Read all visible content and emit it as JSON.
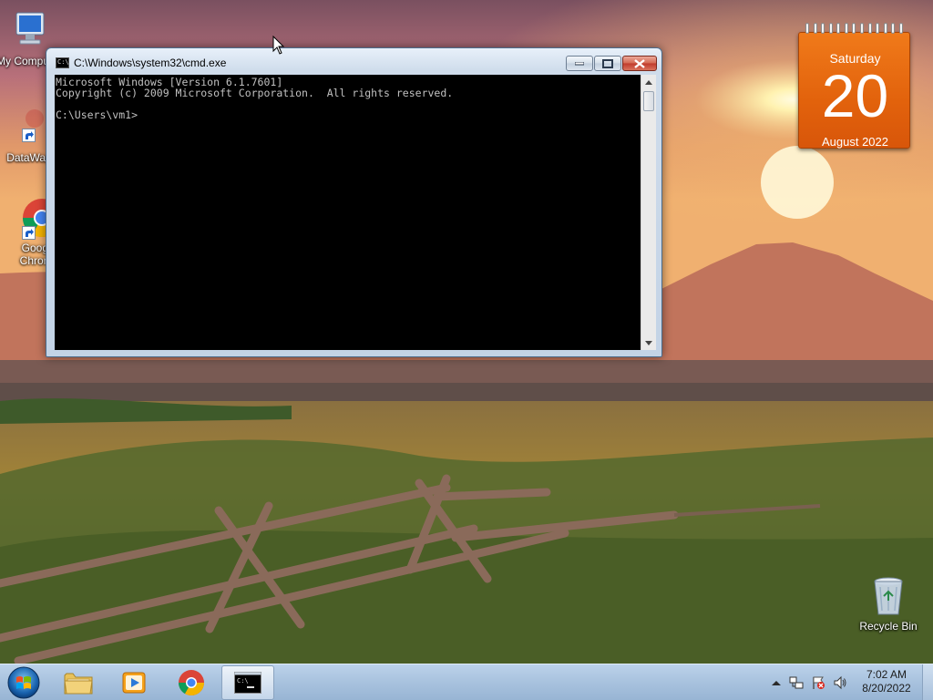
{
  "desktop": {
    "icons": [
      {
        "label": "My Computer",
        "icon": "computer-icon"
      },
      {
        "label": "DataWag",
        "icon": "datawag-shortcut-icon"
      },
      {
        "label": "Google Chrome",
        "icon": "chrome-icon"
      },
      {
        "label": "Recycle Bin",
        "icon": "recycle-bin-icon"
      }
    ]
  },
  "calendar": {
    "day": "Saturday",
    "date": "20",
    "month_year": "August 2022",
    "accent": "#e8660e"
  },
  "cmd_window": {
    "title": "C:\\Windows\\system32\\cmd.exe",
    "lines": [
      "Microsoft Windows [Version 6.1.7601]",
      "Copyright (c) 2009 Microsoft Corporation.  All rights reserved.",
      "",
      "C:\\Users\\vm1>"
    ]
  },
  "taskbar": {
    "start": "windows-orb-icon",
    "pinned": [
      {
        "name": "explorer",
        "icon": "folder-icon"
      },
      {
        "name": "media-player",
        "icon": "media-player-icon"
      },
      {
        "name": "chrome",
        "icon": "chrome-icon"
      },
      {
        "name": "cmd",
        "icon": "command-prompt-icon",
        "active": true
      }
    ],
    "tray": {
      "icons": [
        "show-hidden-icons-icon",
        "network-icon",
        "action-center-icon",
        "volume-icon"
      ],
      "time": "7:02 AM",
      "date": "8/20/2022"
    }
  }
}
